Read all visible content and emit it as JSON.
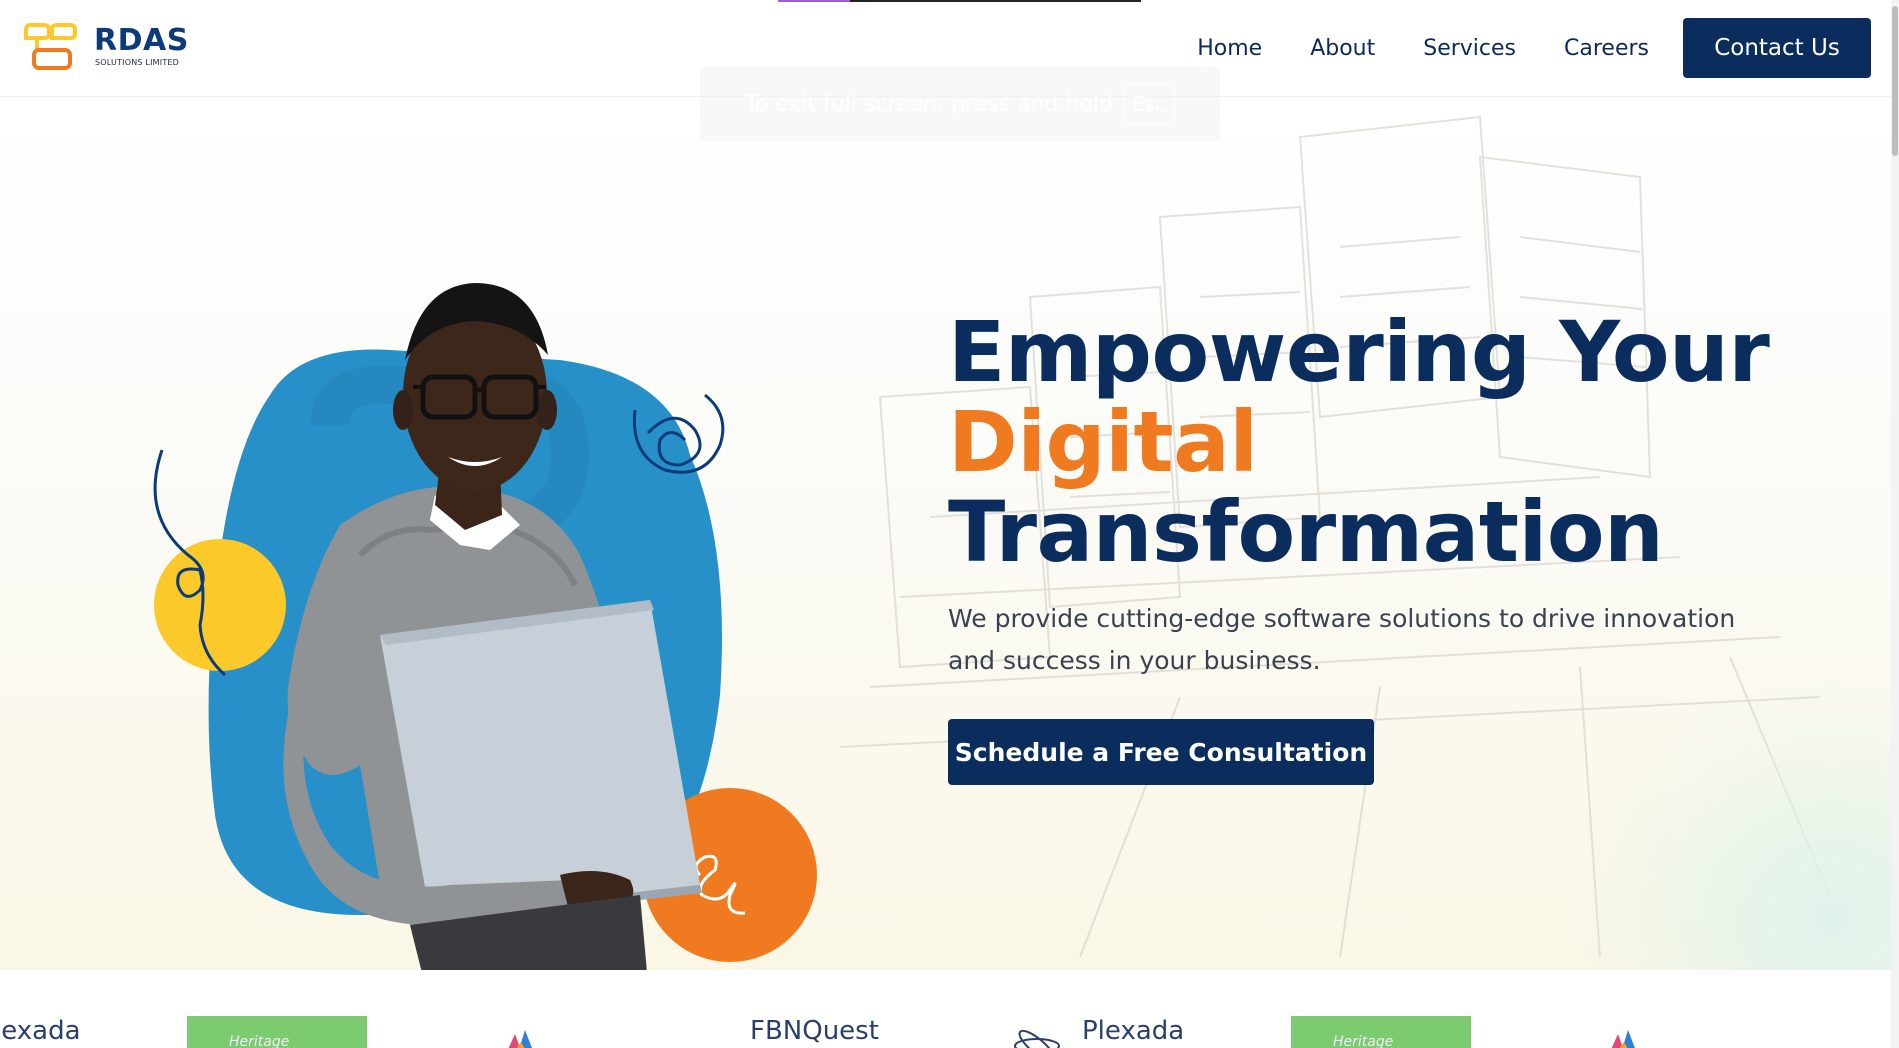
{
  "brand": {
    "name": "RDAS",
    "subtitle": "SOLUTIONS LIMITED",
    "colors": {
      "navy": "#0b2d5e",
      "orange": "#f07a1f",
      "blue": "#2790c9",
      "yellow": "#fcc92a"
    }
  },
  "nav": {
    "items": [
      {
        "label": "Home"
      },
      {
        "label": "About"
      },
      {
        "label": "Services"
      },
      {
        "label": "Careers"
      }
    ],
    "cta": "Contact Us"
  },
  "overlay": {
    "message": "To exit full screen, press and hold",
    "key": "Esc"
  },
  "hero": {
    "headline_line1": "Empowering Your",
    "headline_line2": "Digital",
    "headline_line3": "Transformation",
    "subtext": "We provide cutting-edge software solutions to drive innovation and success in your business.",
    "cta": "Schedule a Free Consultation",
    "image_icon": "man-holding-laptop-illustration"
  },
  "clients": [
    {
      "name": "Plexada",
      "visible_text": "lexada"
    },
    {
      "name": "Heritage",
      "visible_text": "Heritage"
    },
    {
      "name": "flower-logo-icon",
      "visible_text": ""
    },
    {
      "name": "FBNQuest",
      "visible_text": "FBNQuest"
    },
    {
      "name": "Plexada",
      "visible_text": "Plexada"
    },
    {
      "name": "Heritage",
      "visible_text": "Heritage"
    },
    {
      "name": "flower-logo-icon",
      "visible_text": ""
    }
  ]
}
